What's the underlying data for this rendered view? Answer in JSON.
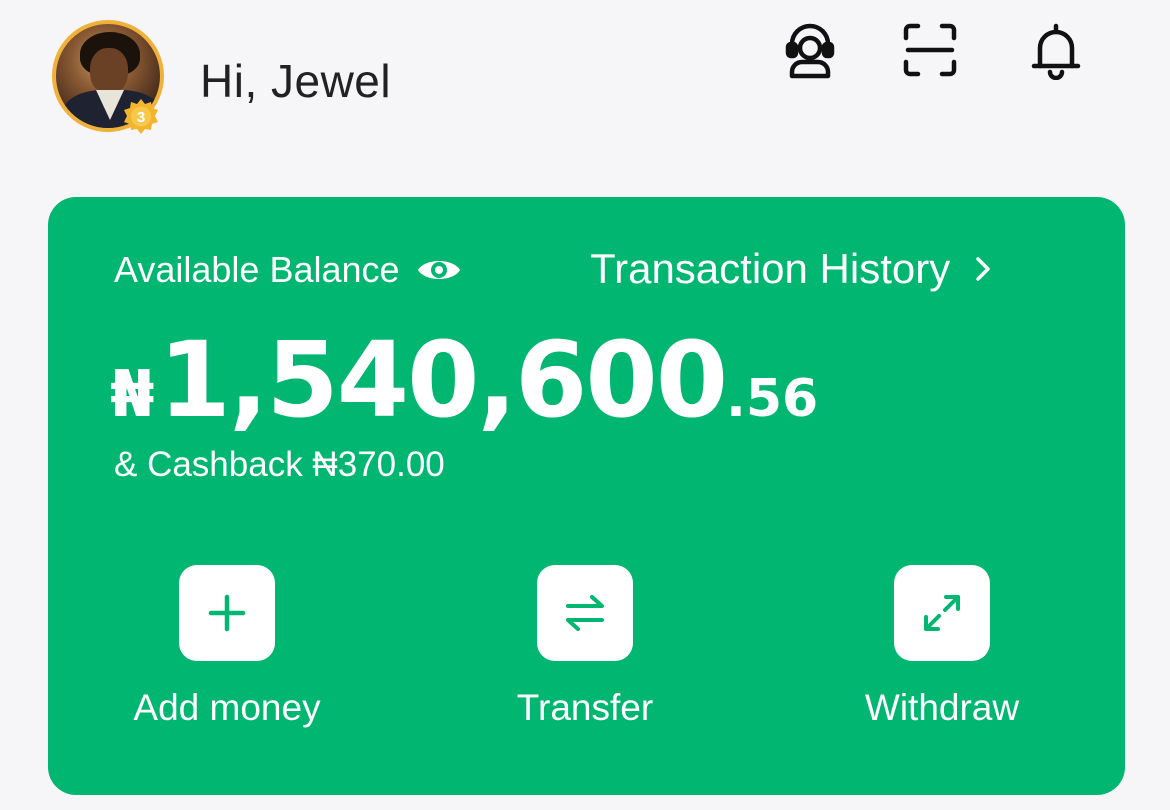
{
  "header": {
    "greeting": "Hi, Jewel",
    "badge_level": "3",
    "icons": [
      "support-agent-icon",
      "scan-icon",
      "bell-icon"
    ]
  },
  "balance_card": {
    "balance_label": "Available Balance",
    "history_label": "Transaction History",
    "currency_symbol": "₦",
    "amount_main": "1,540,600",
    "amount_decimal": ".56",
    "cashback_text": "& Cashback ₦370.00"
  },
  "actions": [
    {
      "label": "Add money",
      "icon": "plus-icon"
    },
    {
      "label": "Transfer",
      "icon": "transfer-arrows-icon"
    },
    {
      "label": "Withdraw",
      "icon": "expand-arrows-icon"
    }
  ],
  "colors": {
    "accent_green": "#00b671",
    "background": "#f6f6f9",
    "badge_gold": "#f0b13a"
  }
}
